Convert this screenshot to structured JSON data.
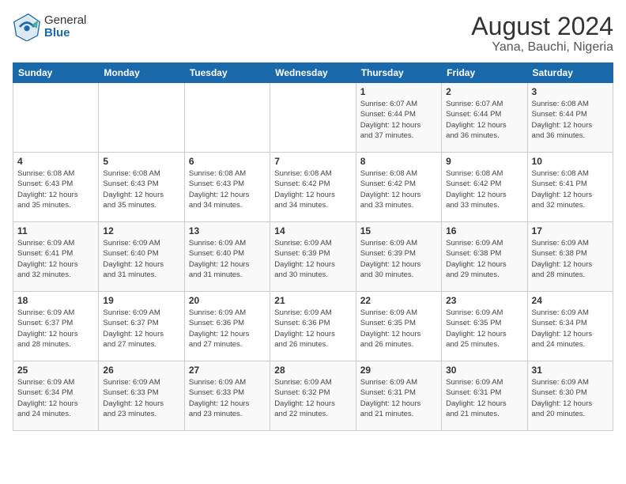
{
  "header": {
    "logo": {
      "line1": "General",
      "line2": "Blue"
    },
    "title": "August 2024",
    "subtitle": "Yana, Bauchi, Nigeria"
  },
  "days_of_week": [
    "Sunday",
    "Monday",
    "Tuesday",
    "Wednesday",
    "Thursday",
    "Friday",
    "Saturday"
  ],
  "weeks": [
    [
      {
        "day": "",
        "info": ""
      },
      {
        "day": "",
        "info": ""
      },
      {
        "day": "",
        "info": ""
      },
      {
        "day": "",
        "info": ""
      },
      {
        "day": "1",
        "info": "Sunrise: 6:07 AM\nSunset: 6:44 PM\nDaylight: 12 hours\nand 37 minutes."
      },
      {
        "day": "2",
        "info": "Sunrise: 6:07 AM\nSunset: 6:44 PM\nDaylight: 12 hours\nand 36 minutes."
      },
      {
        "day": "3",
        "info": "Sunrise: 6:08 AM\nSunset: 6:44 PM\nDaylight: 12 hours\nand 36 minutes."
      }
    ],
    [
      {
        "day": "4",
        "info": "Sunrise: 6:08 AM\nSunset: 6:43 PM\nDaylight: 12 hours\nand 35 minutes."
      },
      {
        "day": "5",
        "info": "Sunrise: 6:08 AM\nSunset: 6:43 PM\nDaylight: 12 hours\nand 35 minutes."
      },
      {
        "day": "6",
        "info": "Sunrise: 6:08 AM\nSunset: 6:43 PM\nDaylight: 12 hours\nand 34 minutes."
      },
      {
        "day": "7",
        "info": "Sunrise: 6:08 AM\nSunset: 6:42 PM\nDaylight: 12 hours\nand 34 minutes."
      },
      {
        "day": "8",
        "info": "Sunrise: 6:08 AM\nSunset: 6:42 PM\nDaylight: 12 hours\nand 33 minutes."
      },
      {
        "day": "9",
        "info": "Sunrise: 6:08 AM\nSunset: 6:42 PM\nDaylight: 12 hours\nand 33 minutes."
      },
      {
        "day": "10",
        "info": "Sunrise: 6:08 AM\nSunset: 6:41 PM\nDaylight: 12 hours\nand 32 minutes."
      }
    ],
    [
      {
        "day": "11",
        "info": "Sunrise: 6:09 AM\nSunset: 6:41 PM\nDaylight: 12 hours\nand 32 minutes."
      },
      {
        "day": "12",
        "info": "Sunrise: 6:09 AM\nSunset: 6:40 PM\nDaylight: 12 hours\nand 31 minutes."
      },
      {
        "day": "13",
        "info": "Sunrise: 6:09 AM\nSunset: 6:40 PM\nDaylight: 12 hours\nand 31 minutes."
      },
      {
        "day": "14",
        "info": "Sunrise: 6:09 AM\nSunset: 6:39 PM\nDaylight: 12 hours\nand 30 minutes."
      },
      {
        "day": "15",
        "info": "Sunrise: 6:09 AM\nSunset: 6:39 PM\nDaylight: 12 hours\nand 30 minutes."
      },
      {
        "day": "16",
        "info": "Sunrise: 6:09 AM\nSunset: 6:38 PM\nDaylight: 12 hours\nand 29 minutes."
      },
      {
        "day": "17",
        "info": "Sunrise: 6:09 AM\nSunset: 6:38 PM\nDaylight: 12 hours\nand 28 minutes."
      }
    ],
    [
      {
        "day": "18",
        "info": "Sunrise: 6:09 AM\nSunset: 6:37 PM\nDaylight: 12 hours\nand 28 minutes."
      },
      {
        "day": "19",
        "info": "Sunrise: 6:09 AM\nSunset: 6:37 PM\nDaylight: 12 hours\nand 27 minutes."
      },
      {
        "day": "20",
        "info": "Sunrise: 6:09 AM\nSunset: 6:36 PM\nDaylight: 12 hours\nand 27 minutes."
      },
      {
        "day": "21",
        "info": "Sunrise: 6:09 AM\nSunset: 6:36 PM\nDaylight: 12 hours\nand 26 minutes."
      },
      {
        "day": "22",
        "info": "Sunrise: 6:09 AM\nSunset: 6:35 PM\nDaylight: 12 hours\nand 26 minutes."
      },
      {
        "day": "23",
        "info": "Sunrise: 6:09 AM\nSunset: 6:35 PM\nDaylight: 12 hours\nand 25 minutes."
      },
      {
        "day": "24",
        "info": "Sunrise: 6:09 AM\nSunset: 6:34 PM\nDaylight: 12 hours\nand 24 minutes."
      }
    ],
    [
      {
        "day": "25",
        "info": "Sunrise: 6:09 AM\nSunset: 6:34 PM\nDaylight: 12 hours\nand 24 minutes."
      },
      {
        "day": "26",
        "info": "Sunrise: 6:09 AM\nSunset: 6:33 PM\nDaylight: 12 hours\nand 23 minutes."
      },
      {
        "day": "27",
        "info": "Sunrise: 6:09 AM\nSunset: 6:33 PM\nDaylight: 12 hours\nand 23 minutes."
      },
      {
        "day": "28",
        "info": "Sunrise: 6:09 AM\nSunset: 6:32 PM\nDaylight: 12 hours\nand 22 minutes."
      },
      {
        "day": "29",
        "info": "Sunrise: 6:09 AM\nSunset: 6:31 PM\nDaylight: 12 hours\nand 21 minutes."
      },
      {
        "day": "30",
        "info": "Sunrise: 6:09 AM\nSunset: 6:31 PM\nDaylight: 12 hours\nand 21 minutes."
      },
      {
        "day": "31",
        "info": "Sunrise: 6:09 AM\nSunset: 6:30 PM\nDaylight: 12 hours\nand 20 minutes."
      }
    ]
  ]
}
